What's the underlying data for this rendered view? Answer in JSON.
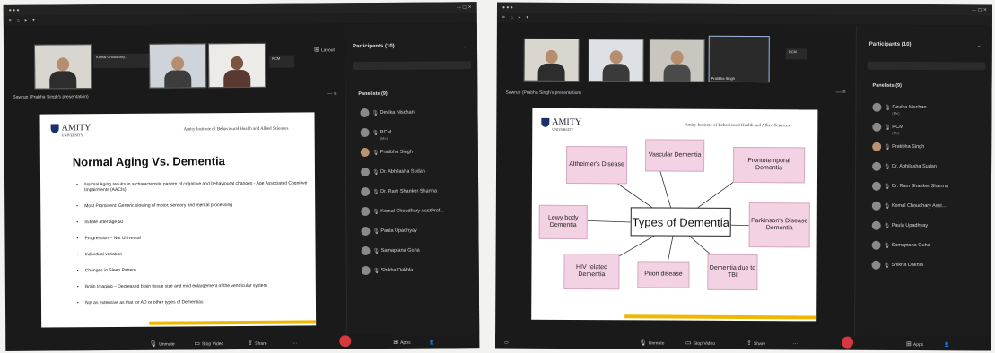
{
  "shot1": {
    "speaker_label": "Sawrup (Prabha Singh's presentation)",
    "thumbs": [
      {
        "name": ""
      },
      {
        "name": "Komal Choudhary..."
      },
      {
        "name": ""
      },
      {
        "name": ""
      }
    ],
    "layout_label": "Layout",
    "slide": {
      "logo": "AMITY",
      "logo_sub": "UNIVERSITY",
      "institute": "Amity Institute of Behavioural Health and Allied Sciences",
      "title": "Normal Aging Vs. Dementia",
      "bullets": [
        "Normal Aging results in a characteristic pattern of cognitive and behavioural changes - Age Associated Cognitive Impairments (AACIs)",
        "Most Prominent: Generic slowing of motor, sensory and mental processing",
        "Initiate after age 50",
        "Progression – Not Universal",
        "Individual variation",
        "Changes in Sleep Pattern",
        "Brain Imaging – Decreased brain tissue size and mild enlargement of the ventricular system",
        "Not as extensive as that for AD or other types of Dementias"
      ]
    },
    "panel": {
      "title": "Participants (10)",
      "section": "Panelists (9)",
      "participants": [
        {
          "name": "Devika Nischan",
          "sub": ""
        },
        {
          "name": "RCM",
          "sub": "(Me)"
        },
        {
          "name": "Pratibha Singh",
          "sub": ""
        },
        {
          "name": "Dr. Abhilasha Sudan",
          "sub": ""
        },
        {
          "name": "Dr. Ram Shanker Sharma",
          "sub": ""
        },
        {
          "name": "Komal Choudhary AsstProf...",
          "sub": ""
        },
        {
          "name": "Paula Upadhyay",
          "sub": ""
        },
        {
          "name": "Samaptana Guha",
          "sub": ""
        },
        {
          "name": "Shikha Dakhla",
          "sub": ""
        }
      ]
    },
    "toolbar": {
      "unmute": "Unmute",
      "stop_video": "Stop Video",
      "share": "Share",
      "apps": "Apps"
    }
  },
  "shot2": {
    "speaker_label": "Sawrup (Prabha Singh's presentation)",
    "thumbs": [
      {
        "name": ""
      },
      {
        "name": ""
      },
      {
        "name": ""
      },
      {
        "name": "Pratibha Singh"
      }
    ],
    "panel": {
      "title": "Participants (10)",
      "section": "Panelists (9)",
      "participants": [
        {
          "name": "Devika Nischan",
          "sub": "(Me)"
        },
        {
          "name": "RCM",
          "sub": "(Me)"
        },
        {
          "name": "Pratibha Singh",
          "sub": ""
        },
        {
          "name": "Dr. Abhilasha Sudan",
          "sub": ""
        },
        {
          "name": "Dr. Ram Shanker Sharma",
          "sub": ""
        },
        {
          "name": "Komal Choudhary Asst...",
          "sub": ""
        },
        {
          "name": "Paula Upadhyay",
          "sub": ""
        },
        {
          "name": "Samaptana Guha",
          "sub": ""
        },
        {
          "name": "Shikha Dakhla",
          "sub": ""
        }
      ]
    },
    "slide": {
      "logo": "AMITY",
      "logo_sub": "UNIVERSITY",
      "institute": "Amity Institute of Behavioural Health and Allied Sciences",
      "center": "Types of Dementia",
      "types": [
        "Altheimer's Disease",
        "Vascular Dementia",
        "Frontotemporal Dementia",
        "Parkinson's Disease Dementia",
        "Dementia due to TBI",
        "Prion disease",
        "HIV related Dementia",
        "Lewy body Dementia"
      ]
    },
    "toolbar": {
      "unmute": "Unmute",
      "stop_video": "Stop Video",
      "share": "Share",
      "apps": "Apps"
    }
  }
}
